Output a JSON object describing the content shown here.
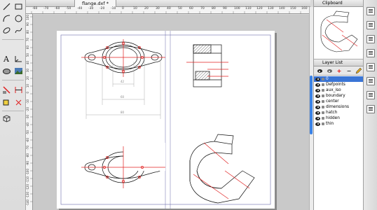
{
  "document": {
    "tab_title": "flange.dxf *"
  },
  "rulers": {
    "horizontal": [
      "-60",
      "-70",
      "-60",
      "-50",
      "-40",
      "-30",
      "-20",
      "-10",
      "0",
      "10",
      "20",
      "30",
      "40",
      "50",
      "60",
      "70",
      "80",
      "90",
      "100",
      "110",
      "120",
      "130",
      "140",
      "150",
      "160"
    ],
    "vertical": [
      "100",
      "90",
      "80",
      "70",
      "60",
      "50",
      "40",
      "30",
      "20",
      "10",
      "0",
      "-10",
      "-20",
      "-30",
      "-40",
      "-50",
      "-60",
      "-70",
      "-80",
      "-90",
      "-100",
      "-110",
      "-120",
      "-130",
      "-140"
    ]
  },
  "drawing": {
    "dims": {
      "d1": "42",
      "d2": "60",
      "d3": "80"
    }
  },
  "panels": {
    "clipboard_title": "Clipboard",
    "layer_list_title": "Layer List",
    "layer_tools": {
      "add": "+",
      "remove": "−"
    },
    "layers": [
      {
        "name": "0",
        "selected": true
      },
      {
        "name": "Defpoints",
        "selected": false
      },
      {
        "name": "aux_iso",
        "selected": false
      },
      {
        "name": "boundary",
        "selected": false
      },
      {
        "name": "center",
        "selected": false
      },
      {
        "name": "dimensions",
        "selected": false
      },
      {
        "name": "hatch",
        "selected": false
      },
      {
        "name": "hidden",
        "selected": false
      },
      {
        "name": "thin",
        "selected": false
      }
    ]
  },
  "colors": {
    "selection": "#3a75d6",
    "accent_red": "#e02020",
    "scroll_thumb": "#3a82e6"
  },
  "icons": [
    "line-icon",
    "rectangle-icon",
    "arc-icon",
    "circle-icon",
    "ellipse-icon",
    "spline-icon",
    "text-icon",
    "dimension-icon",
    "hatch-icon",
    "image-icon",
    "modify-icon",
    "trim-icon",
    "move-icon",
    "snap-icon",
    "3d-box-icon"
  ]
}
